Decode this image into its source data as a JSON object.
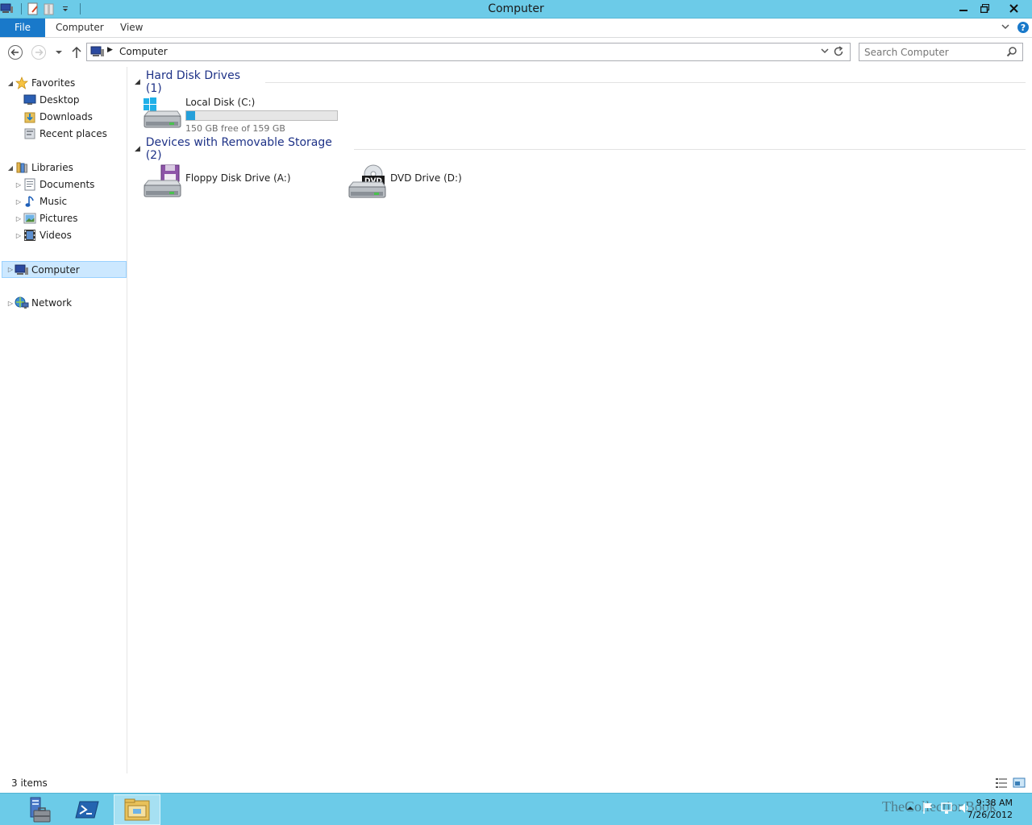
{
  "window": {
    "title": "Computer"
  },
  "ribbon": {
    "tabs": [
      {
        "label": "File"
      },
      {
        "label": "Computer"
      },
      {
        "label": "View"
      }
    ]
  },
  "navbar": {
    "address_crumb": "Computer",
    "search_placeholder": "Search Computer"
  },
  "navpane": {
    "favorites": {
      "label": "Favorites",
      "items": [
        {
          "label": "Desktop"
        },
        {
          "label": "Downloads"
        },
        {
          "label": "Recent places"
        }
      ]
    },
    "libraries": {
      "label": "Libraries",
      "items": [
        {
          "label": "Documents"
        },
        {
          "label": "Music"
        },
        {
          "label": "Pictures"
        },
        {
          "label": "Videos"
        }
      ]
    },
    "computer": {
      "label": "Computer"
    },
    "network": {
      "label": "Network"
    }
  },
  "content": {
    "groups": [
      {
        "name": "Hard Disk Drives (1)",
        "drives": [
          {
            "name": "Local Disk (C:)",
            "free_text": "150 GB free of 159 GB",
            "used_fraction": 0.057
          }
        ]
      },
      {
        "name": "Devices with Removable Storage (2)",
        "drives": [
          {
            "name": "Floppy Disk Drive (A:)"
          },
          {
            "name": "DVD Drive (D:)",
            "badge": "DVD"
          }
        ]
      }
    ]
  },
  "statusbar": {
    "count": "3 items"
  },
  "taskbar": {
    "clock_time": "9:38 AM",
    "clock_date": "7/26/2012",
    "watermark": "TheCollectionBook"
  },
  "colors": {
    "titlebar": "#6ccbe8",
    "file_tab": "#1979ca",
    "group_header": "#1e3287",
    "progress_fill": "#26a0da",
    "selection": "#cce8ff"
  }
}
